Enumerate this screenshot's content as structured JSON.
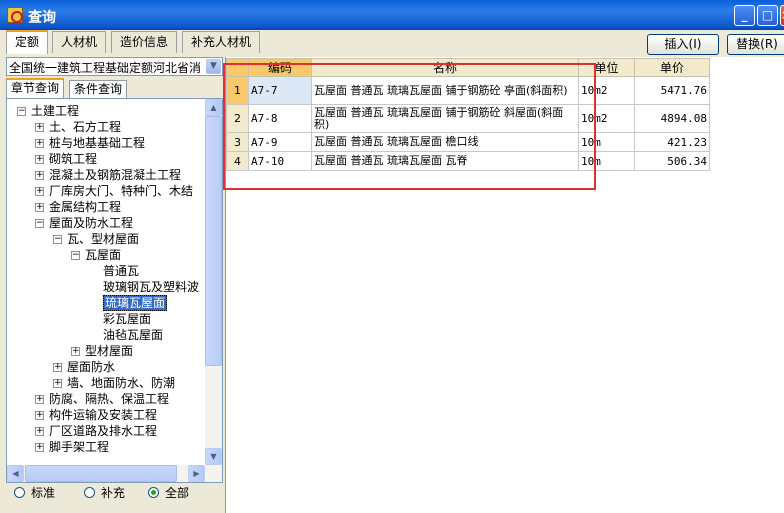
{
  "window": {
    "title": "查询",
    "min_label": "_",
    "max_label": "□",
    "close_label": "×"
  },
  "tabs": [
    {
      "label": "定额"
    },
    {
      "label": "人材机"
    },
    {
      "label": "造价信息"
    },
    {
      "label": "补充人材机"
    }
  ],
  "buttons": {
    "insert": "插入(I)",
    "replace": "替换(R)"
  },
  "left": {
    "dropdown_value": "全国统一建筑工程基础定额河北省消",
    "subtabs": [
      "章节查询",
      "条件查询"
    ],
    "tree": [
      {
        "label": "土建工程",
        "level": 0,
        "expander": "−"
      },
      {
        "label": "土、石方工程",
        "level": 1,
        "expander": "+"
      },
      {
        "label": "桩与地基基础工程",
        "level": 1,
        "expander": "+"
      },
      {
        "label": "砌筑工程",
        "level": 1,
        "expander": "+"
      },
      {
        "label": "混凝土及钢筋混凝土工程",
        "level": 1,
        "expander": "+"
      },
      {
        "label": "厂库房大门、特种门、木结",
        "level": 1,
        "expander": "+"
      },
      {
        "label": "金属结构工程",
        "level": 1,
        "expander": "+"
      },
      {
        "label": "屋面及防水工程",
        "level": 1,
        "expander": "−"
      },
      {
        "label": "瓦、型材屋面",
        "level": 2,
        "expander": "−"
      },
      {
        "label": "瓦屋面",
        "level": 3,
        "expander": "−"
      },
      {
        "label": "普通瓦",
        "level": 4,
        "expander": ""
      },
      {
        "label": "玻璃钢瓦及塑料波",
        "level": 4,
        "expander": ""
      },
      {
        "label": "琉璃瓦屋面",
        "level": 4,
        "expander": "",
        "selected": true
      },
      {
        "label": "彩瓦屋面",
        "level": 4,
        "expander": ""
      },
      {
        "label": "油毡瓦屋面",
        "level": 4,
        "expander": ""
      },
      {
        "label": "型材屋面",
        "level": 3,
        "expander": "+"
      },
      {
        "label": "屋面防水",
        "level": 2,
        "expander": "+"
      },
      {
        "label": "墙、地面防水、防潮",
        "level": 2,
        "expander": "+"
      },
      {
        "label": "防腐、隔热、保温工程",
        "level": 1,
        "expander": "+"
      },
      {
        "label": "构件运输及安装工程",
        "level": 1,
        "expander": "+"
      },
      {
        "label": "厂区道路及排水工程",
        "level": 1,
        "expander": "+"
      },
      {
        "label": "脚手架工程",
        "level": 1,
        "expander": "+"
      }
    ],
    "radios": [
      {
        "label": "标准",
        "checked": false
      },
      {
        "label": "补充",
        "checked": false
      },
      {
        "label": "全部",
        "checked": true
      }
    ]
  },
  "table": {
    "headers": [
      "",
      "编码",
      "名称",
      "单位",
      "单价"
    ],
    "rows": [
      {
        "num": "1",
        "code": "A7-7",
        "name": "瓦屋面 普通瓦 琉璃瓦屋面 铺于钢筋砼 斜面积)",
        "unit": "10m2",
        "price": "5471.76"
      },
      {
        "num": "2",
        "code": "A7-8",
        "name": "瓦屋面 普通瓦 琉璃瓦屋面 铺于钢筋砼 斜屋面(斜面积)",
        "unit": "10m2",
        "price": "4894.08"
      },
      {
        "num": "3",
        "code": "A7-9",
        "name": "瓦屋面 普通瓦 琉璃瓦屋面 檐口线",
        "unit": "10m",
        "price": "421.23"
      },
      {
        "num": "4",
        "code": "A7-10",
        "name": "瓦屋面 普通瓦 琉璃瓦屋面 瓦脊",
        "unit": "10m",
        "price": "506.34"
      }
    ]
  },
  "row1_name_full": "瓦屋面 普通瓦 琉璃瓦屋面 铺于钢筋砼 亭面(斜面积)"
}
